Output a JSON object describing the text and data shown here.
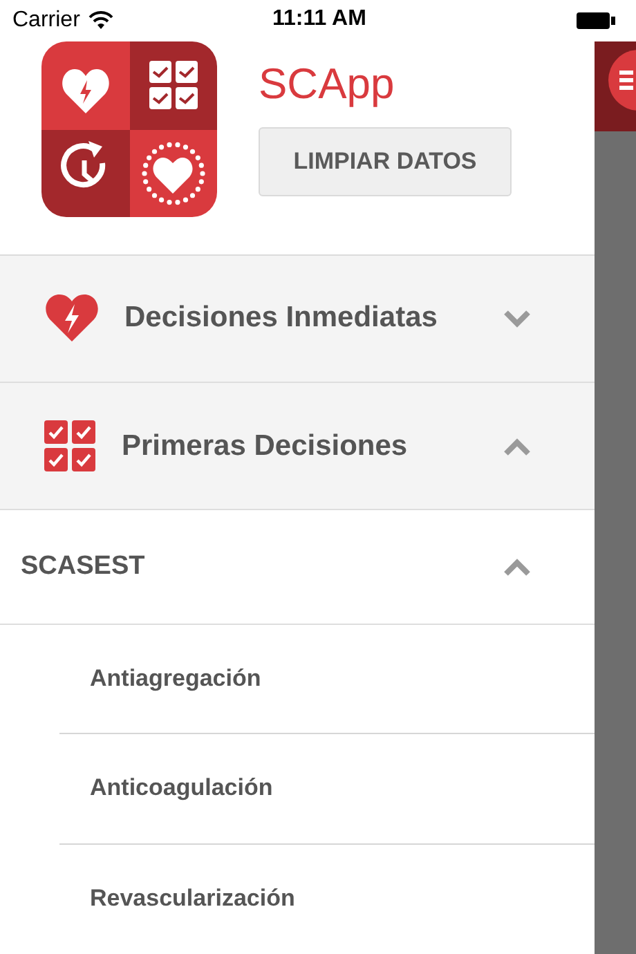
{
  "status_bar": {
    "carrier": "Carrier",
    "time": "11:11 AM"
  },
  "app": {
    "title": "SCApp"
  },
  "clear_button": {
    "label": "LIMPIAR DATOS"
  },
  "menu": [
    {
      "kind": "heart",
      "label": "Decisiones Inmediatas",
      "expanded": false
    },
    {
      "kind": "checklist",
      "label": "Primeras Decisiones",
      "expanded": true,
      "children": [
        {
          "label": "SCASEST",
          "expanded": true,
          "children": [
            {
              "label": "Antiagregación"
            },
            {
              "label": "Anticoagulación"
            },
            {
              "label": "Revascularización"
            }
          ]
        }
      ]
    }
  ]
}
